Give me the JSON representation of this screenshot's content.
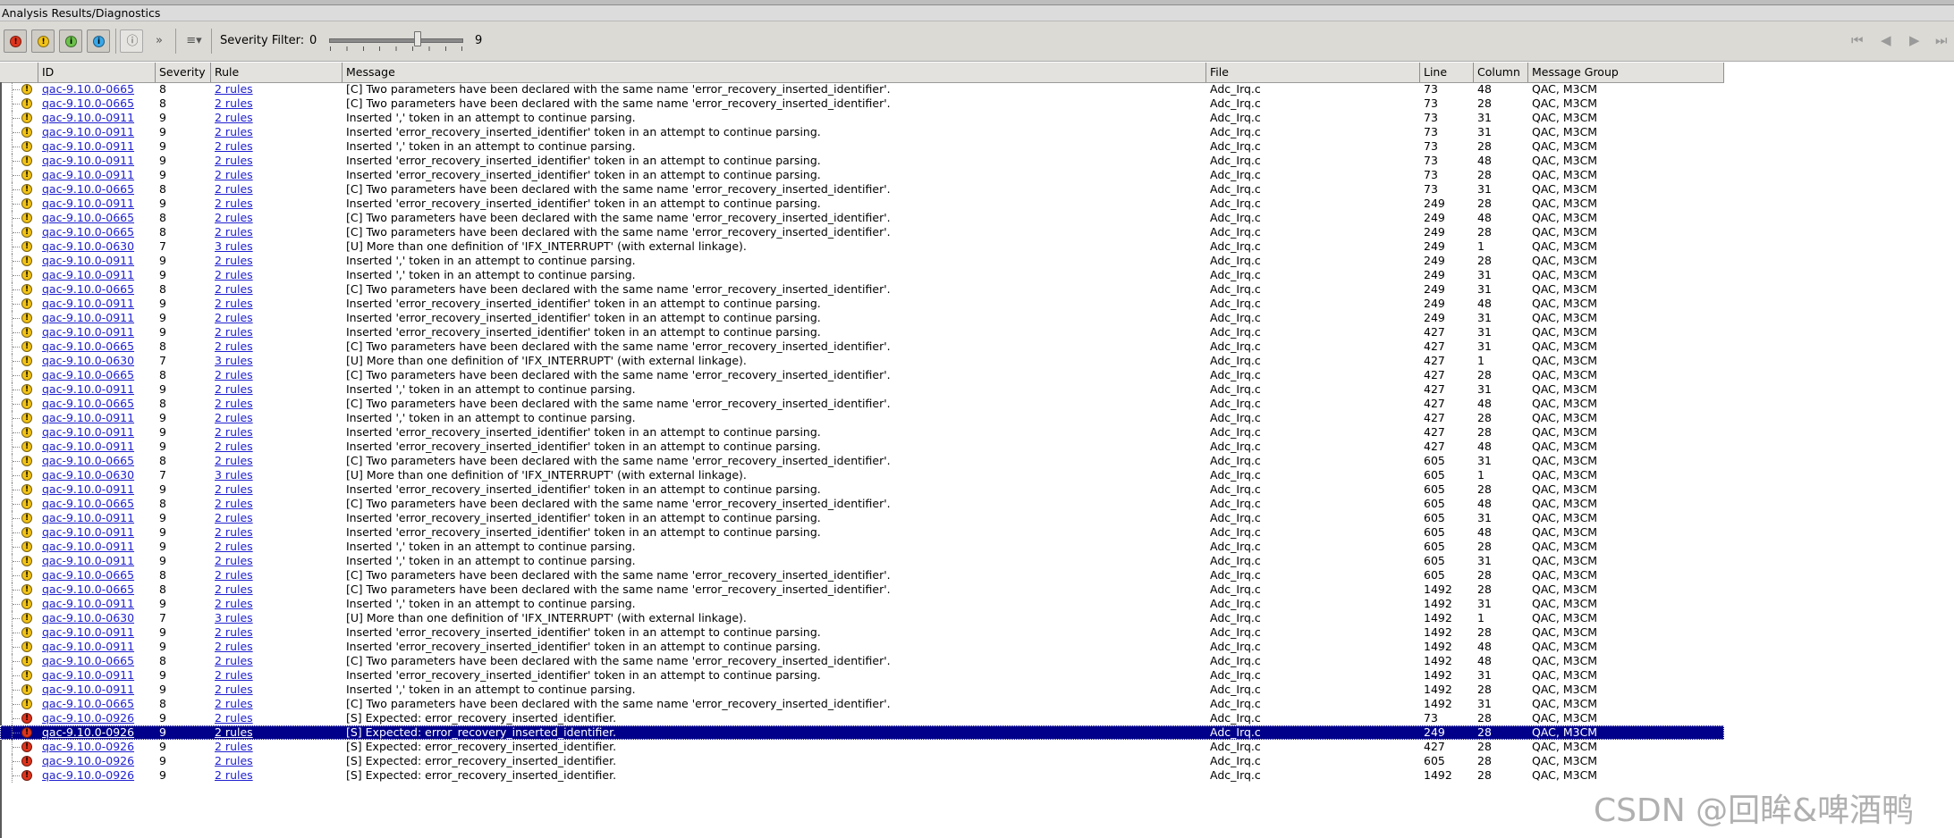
{
  "panel": {
    "title": "Analysis Results/Diagnostics"
  },
  "toolbar": {
    "severity_buttons": [
      {
        "name": "error-filter",
        "glyph": "!",
        "color": "#e0341c"
      },
      {
        "name": "warning-filter",
        "glyph": "!",
        "color": "#f2c318"
      },
      {
        "name": "info-filter",
        "glyph": "i",
        "color": "#6cc24a"
      },
      {
        "name": "note-filter",
        "glyph": "i",
        "color": "#38a7e8"
      }
    ],
    "severity_filter_label": "Severity Filter:",
    "severity_min": "0",
    "severity_max": "9",
    "severity_value": 7,
    "nav_icons": [
      "first-page-icon",
      "previous-icon",
      "next-icon",
      "last-page-icon"
    ]
  },
  "colors": {
    "error": "#e0341c",
    "warning": "#f2c318",
    "selection": "#00008b",
    "link": "#1f1fd1"
  },
  "table": {
    "columns": [
      "ID",
      "Severity",
      "Rule",
      "Message",
      "File",
      "Line",
      "Column",
      "Message Group"
    ],
    "selected_index": 45,
    "rows": [
      {
        "icon": "warning",
        "id": "qac-9.10.0-0665",
        "sev": "8",
        "rule": "2 rules",
        "msg": "[C] Two parameters have been declared with the same name 'error_recovery_inserted_identifier'.",
        "file": "Adc_Irq.c",
        "line": "73",
        "col": "48",
        "group": "QAC, M3CM"
      },
      {
        "icon": "warning",
        "id": "qac-9.10.0-0665",
        "sev": "8",
        "rule": "2 rules",
        "msg": "[C] Two parameters have been declared with the same name 'error_recovery_inserted_identifier'.",
        "file": "Adc_Irq.c",
        "line": "73",
        "col": "28",
        "group": "QAC, M3CM"
      },
      {
        "icon": "warning",
        "id": "qac-9.10.0-0911",
        "sev": "9",
        "rule": "2 rules",
        "msg": "Inserted ',' token in an attempt to continue parsing.",
        "file": "Adc_Irq.c",
        "line": "73",
        "col": "31",
        "group": "QAC, M3CM"
      },
      {
        "icon": "warning",
        "id": "qac-9.10.0-0911",
        "sev": "9",
        "rule": "2 rules",
        "msg": "Inserted 'error_recovery_inserted_identifier' token in an attempt to continue parsing.",
        "file": "Adc_Irq.c",
        "line": "73",
        "col": "31",
        "group": "QAC, M3CM"
      },
      {
        "icon": "warning",
        "id": "qac-9.10.0-0911",
        "sev": "9",
        "rule": "2 rules",
        "msg": "Inserted ',' token in an attempt to continue parsing.",
        "file": "Adc_Irq.c",
        "line": "73",
        "col": "28",
        "group": "QAC, M3CM"
      },
      {
        "icon": "warning",
        "id": "qac-9.10.0-0911",
        "sev": "9",
        "rule": "2 rules",
        "msg": "Inserted 'error_recovery_inserted_identifier' token in an attempt to continue parsing.",
        "file": "Adc_Irq.c",
        "line": "73",
        "col": "48",
        "group": "QAC, M3CM"
      },
      {
        "icon": "warning",
        "id": "qac-9.10.0-0911",
        "sev": "9",
        "rule": "2 rules",
        "msg": "Inserted 'error_recovery_inserted_identifier' token in an attempt to continue parsing.",
        "file": "Adc_Irq.c",
        "line": "73",
        "col": "28",
        "group": "QAC, M3CM"
      },
      {
        "icon": "warning",
        "id": "qac-9.10.0-0665",
        "sev": "8",
        "rule": "2 rules",
        "msg": "[C] Two parameters have been declared with the same name 'error_recovery_inserted_identifier'.",
        "file": "Adc_Irq.c",
        "line": "73",
        "col": "31",
        "group": "QAC, M3CM"
      },
      {
        "icon": "warning",
        "id": "qac-9.10.0-0911",
        "sev": "9",
        "rule": "2 rules",
        "msg": "Inserted 'error_recovery_inserted_identifier' token in an attempt to continue parsing.",
        "file": "Adc_Irq.c",
        "line": "249",
        "col": "28",
        "group": "QAC, M3CM"
      },
      {
        "icon": "warning",
        "id": "qac-9.10.0-0665",
        "sev": "8",
        "rule": "2 rules",
        "msg": "[C] Two parameters have been declared with the same name 'error_recovery_inserted_identifier'.",
        "file": "Adc_Irq.c",
        "line": "249",
        "col": "48",
        "group": "QAC, M3CM"
      },
      {
        "icon": "warning",
        "id": "qac-9.10.0-0665",
        "sev": "8",
        "rule": "2 rules",
        "msg": "[C] Two parameters have been declared with the same name 'error_recovery_inserted_identifier'.",
        "file": "Adc_Irq.c",
        "line": "249",
        "col": "28",
        "group": "QAC, M3CM"
      },
      {
        "icon": "warning",
        "id": "qac-9.10.0-0630",
        "sev": "7",
        "rule": "3 rules",
        "msg": "[U] More than one definition of 'IFX_INTERRUPT' (with external linkage).",
        "file": "Adc_Irq.c",
        "line": "249",
        "col": "1",
        "group": "QAC, M3CM"
      },
      {
        "icon": "warning",
        "id": "qac-9.10.0-0911",
        "sev": "9",
        "rule": "2 rules",
        "msg": "Inserted ',' token in an attempt to continue parsing.",
        "file": "Adc_Irq.c",
        "line": "249",
        "col": "28",
        "group": "QAC, M3CM"
      },
      {
        "icon": "warning",
        "id": "qac-9.10.0-0911",
        "sev": "9",
        "rule": "2 rules",
        "msg": "Inserted ',' token in an attempt to continue parsing.",
        "file": "Adc_Irq.c",
        "line": "249",
        "col": "31",
        "group": "QAC, M3CM"
      },
      {
        "icon": "warning",
        "id": "qac-9.10.0-0665",
        "sev": "8",
        "rule": "2 rules",
        "msg": "[C] Two parameters have been declared with the same name 'error_recovery_inserted_identifier'.",
        "file": "Adc_Irq.c",
        "line": "249",
        "col": "31",
        "group": "QAC, M3CM"
      },
      {
        "icon": "warning",
        "id": "qac-9.10.0-0911",
        "sev": "9",
        "rule": "2 rules",
        "msg": "Inserted 'error_recovery_inserted_identifier' token in an attempt to continue parsing.",
        "file": "Adc_Irq.c",
        "line": "249",
        "col": "48",
        "group": "QAC, M3CM"
      },
      {
        "icon": "warning",
        "id": "qac-9.10.0-0911",
        "sev": "9",
        "rule": "2 rules",
        "msg": "Inserted 'error_recovery_inserted_identifier' token in an attempt to continue parsing.",
        "file": "Adc_Irq.c",
        "line": "249",
        "col": "31",
        "group": "QAC, M3CM"
      },
      {
        "icon": "warning",
        "id": "qac-9.10.0-0911",
        "sev": "9",
        "rule": "2 rules",
        "msg": "Inserted 'error_recovery_inserted_identifier' token in an attempt to continue parsing.",
        "file": "Adc_Irq.c",
        "line": "427",
        "col": "31",
        "group": "QAC, M3CM"
      },
      {
        "icon": "warning",
        "id": "qac-9.10.0-0665",
        "sev": "8",
        "rule": "2 rules",
        "msg": "[C] Two parameters have been declared with the same name 'error_recovery_inserted_identifier'.",
        "file": "Adc_Irq.c",
        "line": "427",
        "col": "31",
        "group": "QAC, M3CM"
      },
      {
        "icon": "warning",
        "id": "qac-9.10.0-0630",
        "sev": "7",
        "rule": "3 rules",
        "msg": "[U] More than one definition of 'IFX_INTERRUPT' (with external linkage).",
        "file": "Adc_Irq.c",
        "line": "427",
        "col": "1",
        "group": "QAC, M3CM"
      },
      {
        "icon": "warning",
        "id": "qac-9.10.0-0665",
        "sev": "8",
        "rule": "2 rules",
        "msg": "[C] Two parameters have been declared with the same name 'error_recovery_inserted_identifier'.",
        "file": "Adc_Irq.c",
        "line": "427",
        "col": "28",
        "group": "QAC, M3CM"
      },
      {
        "icon": "warning",
        "id": "qac-9.10.0-0911",
        "sev": "9",
        "rule": "2 rules",
        "msg": "Inserted ',' token in an attempt to continue parsing.",
        "file": "Adc_Irq.c",
        "line": "427",
        "col": "31",
        "group": "QAC, M3CM"
      },
      {
        "icon": "warning",
        "id": "qac-9.10.0-0665",
        "sev": "8",
        "rule": "2 rules",
        "msg": "[C] Two parameters have been declared with the same name 'error_recovery_inserted_identifier'.",
        "file": "Adc_Irq.c",
        "line": "427",
        "col": "48",
        "group": "QAC, M3CM"
      },
      {
        "icon": "warning",
        "id": "qac-9.10.0-0911",
        "sev": "9",
        "rule": "2 rules",
        "msg": "Inserted ',' token in an attempt to continue parsing.",
        "file": "Adc_Irq.c",
        "line": "427",
        "col": "28",
        "group": "QAC, M3CM"
      },
      {
        "icon": "warning",
        "id": "qac-9.10.0-0911",
        "sev": "9",
        "rule": "2 rules",
        "msg": "Inserted 'error_recovery_inserted_identifier' token in an attempt to continue parsing.",
        "file": "Adc_Irq.c",
        "line": "427",
        "col": "28",
        "group": "QAC, M3CM"
      },
      {
        "icon": "warning",
        "id": "qac-9.10.0-0911",
        "sev": "9",
        "rule": "2 rules",
        "msg": "Inserted 'error_recovery_inserted_identifier' token in an attempt to continue parsing.",
        "file": "Adc_Irq.c",
        "line": "427",
        "col": "48",
        "group": "QAC, M3CM"
      },
      {
        "icon": "warning",
        "id": "qac-9.10.0-0665",
        "sev": "8",
        "rule": "2 rules",
        "msg": "[C] Two parameters have been declared with the same name 'error_recovery_inserted_identifier'.",
        "file": "Adc_Irq.c",
        "line": "605",
        "col": "31",
        "group": "QAC, M3CM"
      },
      {
        "icon": "warning",
        "id": "qac-9.10.0-0630",
        "sev": "7",
        "rule": "3 rules",
        "msg": "[U] More than one definition of 'IFX_INTERRUPT' (with external linkage).",
        "file": "Adc_Irq.c",
        "line": "605",
        "col": "1",
        "group": "QAC, M3CM"
      },
      {
        "icon": "warning",
        "id": "qac-9.10.0-0911",
        "sev": "9",
        "rule": "2 rules",
        "msg": "Inserted 'error_recovery_inserted_identifier' token in an attempt to continue parsing.",
        "file": "Adc_Irq.c",
        "line": "605",
        "col": "28",
        "group": "QAC, M3CM"
      },
      {
        "icon": "warning",
        "id": "qac-9.10.0-0665",
        "sev": "8",
        "rule": "2 rules",
        "msg": "[C] Two parameters have been declared with the same name 'error_recovery_inserted_identifier'.",
        "file": "Adc_Irq.c",
        "line": "605",
        "col": "48",
        "group": "QAC, M3CM"
      },
      {
        "icon": "warning",
        "id": "qac-9.10.0-0911",
        "sev": "9",
        "rule": "2 rules",
        "msg": "Inserted 'error_recovery_inserted_identifier' token in an attempt to continue parsing.",
        "file": "Adc_Irq.c",
        "line": "605",
        "col": "31",
        "group": "QAC, M3CM"
      },
      {
        "icon": "warning",
        "id": "qac-9.10.0-0911",
        "sev": "9",
        "rule": "2 rules",
        "msg": "Inserted 'error_recovery_inserted_identifier' token in an attempt to continue parsing.",
        "file": "Adc_Irq.c",
        "line": "605",
        "col": "48",
        "group": "QAC, M3CM"
      },
      {
        "icon": "warning",
        "id": "qac-9.10.0-0911",
        "sev": "9",
        "rule": "2 rules",
        "msg": "Inserted ',' token in an attempt to continue parsing.",
        "file": "Adc_Irq.c",
        "line": "605",
        "col": "28",
        "group": "QAC, M3CM"
      },
      {
        "icon": "warning",
        "id": "qac-9.10.0-0911",
        "sev": "9",
        "rule": "2 rules",
        "msg": "Inserted ',' token in an attempt to continue parsing.",
        "file": "Adc_Irq.c",
        "line": "605",
        "col": "31",
        "group": "QAC, M3CM"
      },
      {
        "icon": "warning",
        "id": "qac-9.10.0-0665",
        "sev": "8",
        "rule": "2 rules",
        "msg": "[C] Two parameters have been declared with the same name 'error_recovery_inserted_identifier'.",
        "file": "Adc_Irq.c",
        "line": "605",
        "col": "28",
        "group": "QAC, M3CM"
      },
      {
        "icon": "warning",
        "id": "qac-9.10.0-0665",
        "sev": "8",
        "rule": "2 rules",
        "msg": "[C] Two parameters have been declared with the same name 'error_recovery_inserted_identifier'.",
        "file": "Adc_Irq.c",
        "line": "1492",
        "col": "28",
        "group": "QAC, M3CM"
      },
      {
        "icon": "warning",
        "id": "qac-9.10.0-0911",
        "sev": "9",
        "rule": "2 rules",
        "msg": "Inserted ',' token in an attempt to continue parsing.",
        "file": "Adc_Irq.c",
        "line": "1492",
        "col": "31",
        "group": "QAC, M3CM"
      },
      {
        "icon": "warning",
        "id": "qac-9.10.0-0630",
        "sev": "7",
        "rule": "3 rules",
        "msg": "[U] More than one definition of 'IFX_INTERRUPT' (with external linkage).",
        "file": "Adc_Irq.c",
        "line": "1492",
        "col": "1",
        "group": "QAC, M3CM"
      },
      {
        "icon": "warning",
        "id": "qac-9.10.0-0911",
        "sev": "9",
        "rule": "2 rules",
        "msg": "Inserted 'error_recovery_inserted_identifier' token in an attempt to continue parsing.",
        "file": "Adc_Irq.c",
        "line": "1492",
        "col": "28",
        "group": "QAC, M3CM"
      },
      {
        "icon": "warning",
        "id": "qac-9.10.0-0911",
        "sev": "9",
        "rule": "2 rules",
        "msg": "Inserted 'error_recovery_inserted_identifier' token in an attempt to continue parsing.",
        "file": "Adc_Irq.c",
        "line": "1492",
        "col": "48",
        "group": "QAC, M3CM"
      },
      {
        "icon": "warning",
        "id": "qac-9.10.0-0665",
        "sev": "8",
        "rule": "2 rules",
        "msg": "[C] Two parameters have been declared with the same name 'error_recovery_inserted_identifier'.",
        "file": "Adc_Irq.c",
        "line": "1492",
        "col": "48",
        "group": "QAC, M3CM"
      },
      {
        "icon": "warning",
        "id": "qac-9.10.0-0911",
        "sev": "9",
        "rule": "2 rules",
        "msg": "Inserted 'error_recovery_inserted_identifier' token in an attempt to continue parsing.",
        "file": "Adc_Irq.c",
        "line": "1492",
        "col": "31",
        "group": "QAC, M3CM"
      },
      {
        "icon": "warning",
        "id": "qac-9.10.0-0911",
        "sev": "9",
        "rule": "2 rules",
        "msg": "Inserted ',' token in an attempt to continue parsing.",
        "file": "Adc_Irq.c",
        "line": "1492",
        "col": "28",
        "group": "QAC, M3CM"
      },
      {
        "icon": "warning",
        "id": "qac-9.10.0-0665",
        "sev": "8",
        "rule": "2 rules",
        "msg": "[C] Two parameters have been declared with the same name 'error_recovery_inserted_identifier'.",
        "file": "Adc_Irq.c",
        "line": "1492",
        "col": "31",
        "group": "QAC, M3CM"
      },
      {
        "icon": "error",
        "id": "qac-9.10.0-0926",
        "sev": "9",
        "rule": "2 rules",
        "msg": "[S] Expected: error_recovery_inserted_identifier.",
        "file": "Adc_Irq.c",
        "line": "73",
        "col": "28",
        "group": "QAC, M3CM"
      },
      {
        "icon": "error",
        "id": "qac-9.10.0-0926",
        "sev": "9",
        "rule": "2 rules",
        "msg": "[S] Expected: error_recovery_inserted_identifier.",
        "file": "Adc_Irq.c",
        "line": "249",
        "col": "28",
        "group": "QAC, M3CM"
      },
      {
        "icon": "error",
        "id": "qac-9.10.0-0926",
        "sev": "9",
        "rule": "2 rules",
        "msg": "[S] Expected: error_recovery_inserted_identifier.",
        "file": "Adc_Irq.c",
        "line": "427",
        "col": "28",
        "group": "QAC, M3CM"
      },
      {
        "icon": "error",
        "id": "qac-9.10.0-0926",
        "sev": "9",
        "rule": "2 rules",
        "msg": "[S] Expected: error_recovery_inserted_identifier.",
        "file": "Adc_Irq.c",
        "line": "605",
        "col": "28",
        "group": "QAC, M3CM"
      },
      {
        "icon": "error",
        "id": "qac-9.10.0-0926",
        "sev": "9",
        "rule": "2 rules",
        "msg": "[S] Expected: error_recovery_inserted_identifier.",
        "file": "Adc_Irq.c",
        "line": "1492",
        "col": "28",
        "group": "QAC, M3CM"
      }
    ]
  },
  "watermark": "CSDN @回眸&啤酒鸭"
}
